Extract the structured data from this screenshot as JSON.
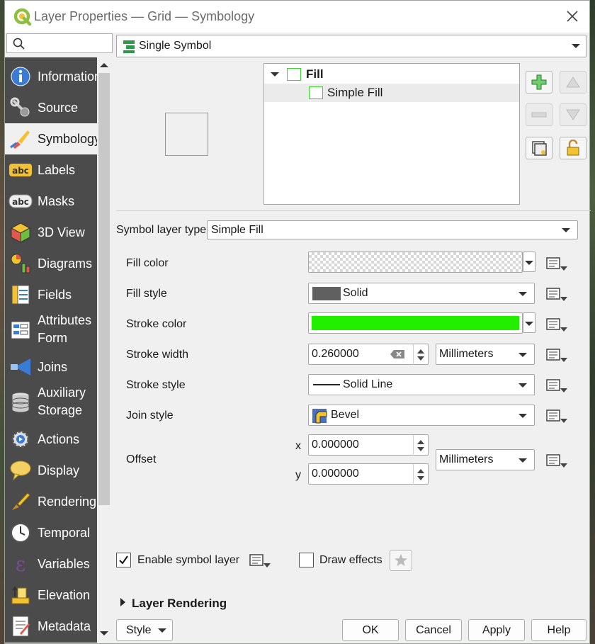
{
  "window": {
    "title": "Layer Properties — Grid — Symbology"
  },
  "search": {
    "placeholder": ""
  },
  "sidebar": {
    "items": [
      {
        "label": "Information",
        "icon": "info-icon"
      },
      {
        "label": "Source",
        "icon": "source-wrench-icon"
      },
      {
        "label": "Symbology",
        "icon": "symbology-brush-icon",
        "active": true
      },
      {
        "label": "Labels",
        "icon": "labels-abc-icon"
      },
      {
        "label": "Masks",
        "icon": "masks-abc-icon"
      },
      {
        "label": "3D View",
        "icon": "cube-3d-icon"
      },
      {
        "label": "Diagrams",
        "icon": "diagrams-icon"
      },
      {
        "label": "Fields",
        "icon": "fields-icon"
      },
      {
        "label": "Attributes",
        "label2": "Form",
        "icon": "attributes-form-icon"
      },
      {
        "label": "Joins",
        "icon": "joins-icon"
      },
      {
        "label": "Auxiliary",
        "label2": "Storage",
        "icon": "auxiliary-storage-icon"
      },
      {
        "label": "Actions",
        "icon": "actions-gear-icon"
      },
      {
        "label": "Display",
        "icon": "display-speech-icon"
      },
      {
        "label": "Rendering",
        "icon": "rendering-brush-icon"
      },
      {
        "label": "Temporal",
        "icon": "temporal-clock-icon"
      },
      {
        "label": "Variables",
        "icon": "variables-epsilon-icon"
      },
      {
        "label": "Elevation",
        "icon": "elevation-icon"
      },
      {
        "label": "Metadata",
        "icon": "metadata-icon"
      }
    ]
  },
  "renderer": {
    "selected": "Single Symbol"
  },
  "symbol_tree": {
    "root": "Fill",
    "child": "Simple Fill"
  },
  "symbol_layer_type": {
    "label": "Symbol layer type",
    "selected": "Simple Fill"
  },
  "properties": {
    "fill_color": {
      "label": "Fill color"
    },
    "fill_style": {
      "label": "Fill style",
      "value": "Solid"
    },
    "stroke_color": {
      "label": "Stroke color",
      "color": "#22ee00"
    },
    "stroke_width": {
      "label": "Stroke width",
      "value": "0.260000",
      "unit": "Millimeters"
    },
    "stroke_style": {
      "label": "Stroke style",
      "value": "Solid Line"
    },
    "join_style": {
      "label": "Join style",
      "value": "Bevel"
    },
    "offset": {
      "label": "Offset",
      "x_label": "x",
      "x_value": "0.000000",
      "y_label": "y",
      "y_value": "0.000000",
      "unit": "Millimeters"
    }
  },
  "enable_symbol_layer": {
    "label": "Enable symbol layer",
    "checked": true
  },
  "draw_effects": {
    "label": "Draw effects",
    "checked": false
  },
  "layer_rendering": {
    "label": "Layer Rendering"
  },
  "buttons": {
    "style": "Style",
    "ok": "OK",
    "cancel": "Cancel",
    "apply": "Apply",
    "help": "Help"
  },
  "colors": {
    "sidebar_bg": "#4b4b4b",
    "accent_green": "#22ee00",
    "preview_stroke": "#26ee11"
  }
}
